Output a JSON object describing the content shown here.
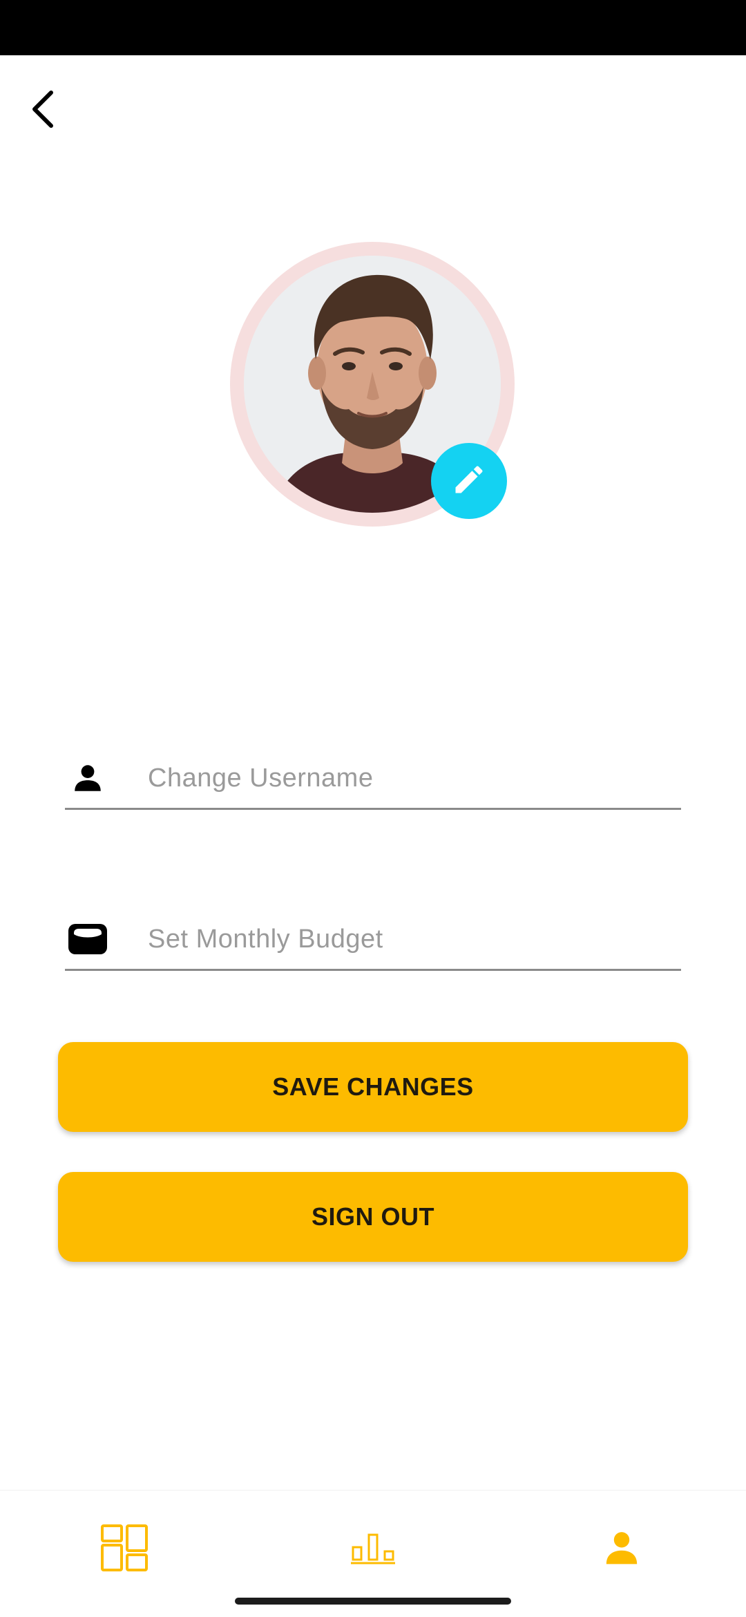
{
  "colors": {
    "accent": "#fdbb00",
    "edit_button": "#14d2f2",
    "avatar_ring": "#f6dede",
    "text_dark": "#1f1a10",
    "placeholder": "#9a9a9a"
  },
  "header": {
    "back_icon": "chevron-left-icon"
  },
  "profile": {
    "avatar_icon": "profile-photo",
    "edit_icon": "pencil-icon"
  },
  "form": {
    "username": {
      "icon": "person-icon",
      "value": "",
      "placeholder": "Change Username"
    },
    "budget": {
      "icon": "wallet-icon",
      "value": "",
      "placeholder": "Set Monthly Budget"
    }
  },
  "actions": {
    "save_label": "SAVE CHANGES",
    "signout_label": "SIGN OUT"
  },
  "bottom_nav": {
    "items": [
      {
        "icon": "dashboard-icon",
        "active": false
      },
      {
        "icon": "bar-chart-icon",
        "active": false
      },
      {
        "icon": "person-icon",
        "active": true
      }
    ]
  }
}
